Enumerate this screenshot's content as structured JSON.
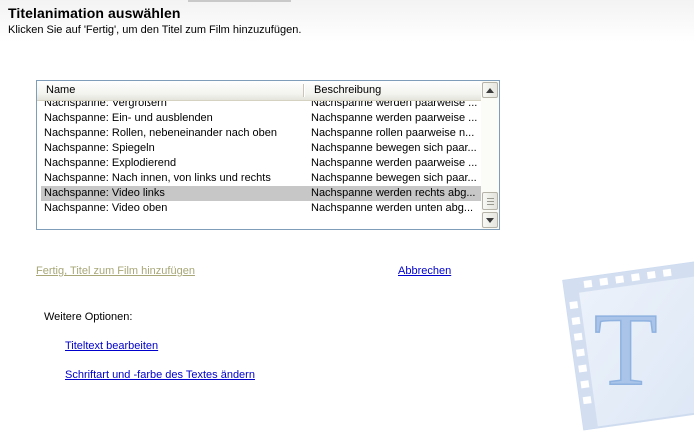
{
  "header": {
    "title": "Titelanimation auswählen",
    "subtitle": "Klicken Sie auf 'Fertig', um den Titel zum Film hinzuzufügen."
  },
  "list": {
    "columns": {
      "name": "Name",
      "description": "Beschreibung"
    },
    "rows": [
      {
        "name": "Nachspanne: Vergrößern",
        "description": "Nachspanne werden paarweise ..."
      },
      {
        "name": "Nachspanne: Ein- und ausblenden",
        "description": "Nachspanne werden paarweise ..."
      },
      {
        "name": "Nachspanne: Rollen, nebeneinander nach oben",
        "description": "Nachspanne rollen paarweise n..."
      },
      {
        "name": "Nachspanne: Spiegeln",
        "description": "Nachspanne bewegen sich paar..."
      },
      {
        "name": "Nachspanne: Explodierend",
        "description": "Nachspanne werden paarweise ..."
      },
      {
        "name": "Nachspanne: Nach innen, von links und rechts",
        "description": "Nachspanne bewegen sich paar..."
      },
      {
        "name": "Nachspanne: Video links",
        "description": "Nachspanne werden rechts abg..."
      },
      {
        "name": "Nachspanne: Video oben",
        "description": "Nachspanne werden unten abg..."
      }
    ],
    "selected_index": 6
  },
  "actions": {
    "done_label": "Fertig, Titel zum Film hinzufügen",
    "cancel_label": "Abbrechen"
  },
  "more_options": {
    "heading": "Weitere Optionen:",
    "edit_text_label": "Titeltext bearbeiten",
    "font_color_label": "Schriftart und -farbe des Textes ändern"
  },
  "watermark": {
    "letter": "T",
    "icon": "title-film-icon"
  },
  "colors": {
    "link": "#0000cc",
    "disabled_link": "#a7a778",
    "selected_row": "#c7c7c7",
    "list_border": "#7f9db9"
  }
}
